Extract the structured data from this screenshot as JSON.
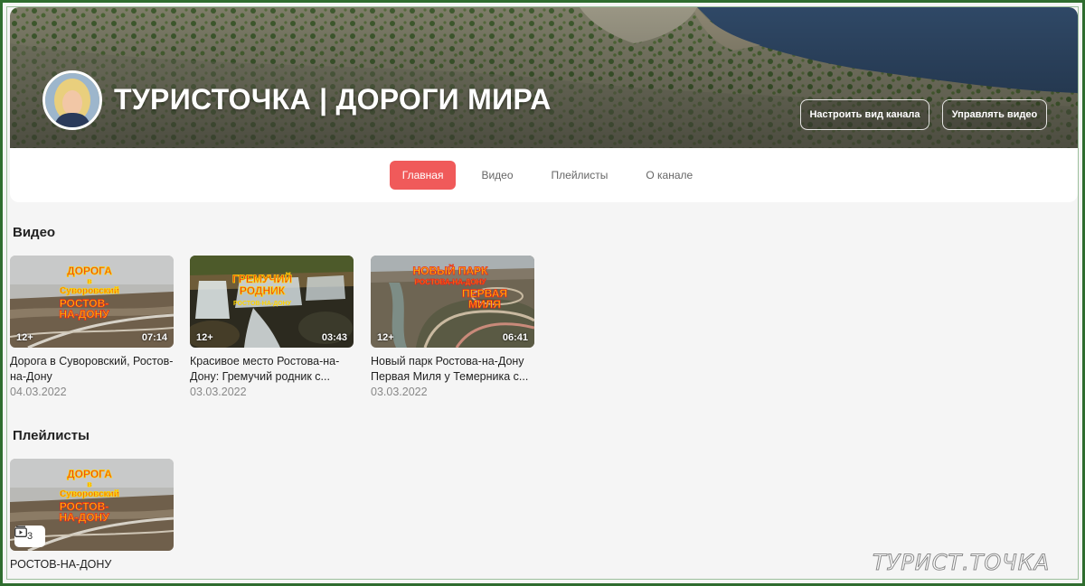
{
  "channel": {
    "title": "ТУРИСТОЧКА | ДОРОГИ МИРА",
    "customize_label": "Настроить вид канала",
    "manage_label": "Управлять видео"
  },
  "tabs": [
    {
      "label": "Главная",
      "active": true
    },
    {
      "label": "Видео",
      "active": false
    },
    {
      "label": "Плейлисты",
      "active": false
    },
    {
      "label": "О канале",
      "active": false
    }
  ],
  "videos_section": {
    "title": "Видео",
    "items": [
      {
        "title": "Дорога в Суворовский, Ростов-на-Дону",
        "date": "04.03.2022",
        "duration": "07:14",
        "age": "12+",
        "thumb_text": [
          "ДОРОГА",
          "в",
          "Суворовский",
          "РОСТОВ-",
          "НА-ДОНУ"
        ]
      },
      {
        "title": "Красивое место Ростова-на-Дону: Гремучий родник с...",
        "date": "03.03.2022",
        "duration": "03:43",
        "age": "12+",
        "thumb_text": [
          "ГРЕМУЧИЙ",
          "РОДНИК",
          "РОСТОВ-НА-ДОНУ"
        ]
      },
      {
        "title": "Новый парк Ростова-на-Дону Первая Миля у Темерника с...",
        "date": "03.03.2022",
        "duration": "06:41",
        "age": "12+",
        "thumb_text": [
          "НОВЫЙ ПАРК",
          "РОСТОВА-НА-ДОНУ",
          "ПЕРВАЯ",
          "МИЛЯ"
        ]
      }
    ]
  },
  "playlists_section": {
    "title": "Плейлисты",
    "items": [
      {
        "title": "РОСТОВ-НА-ДОНУ",
        "count": "3",
        "thumb_text": [
          "ДОРОГА",
          "в",
          "Суворовский",
          "РОСТОВ-",
          "НА-ДОНУ"
        ]
      }
    ]
  },
  "watermark": "ТУРИСТ.ТОЧКА",
  "colors": {
    "accent": "#f05a5a",
    "frame": "#2f6d2f",
    "thumb_text_red": "#e8261c",
    "thumb_text_yellow": "#ffd400"
  }
}
